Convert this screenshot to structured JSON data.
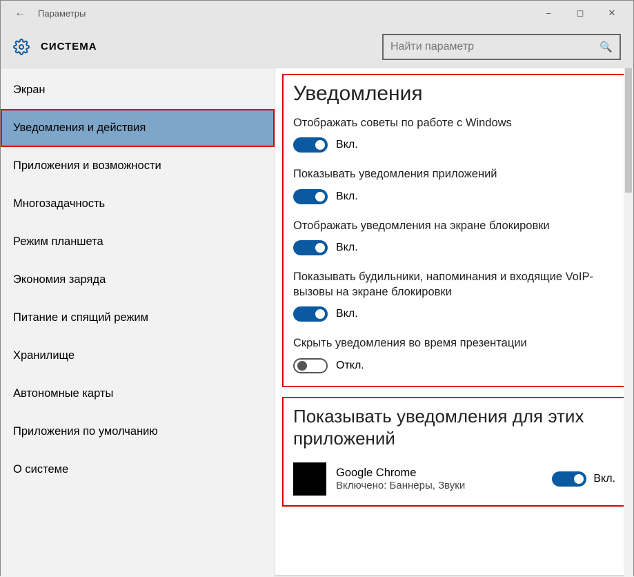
{
  "titlebar": {
    "title": "Параметры"
  },
  "header": {
    "section": "СИСТЕМА",
    "search_placeholder": "Найти параметр"
  },
  "sidebar": {
    "items": [
      {
        "label": "Экран"
      },
      {
        "label": "Уведомления и действия"
      },
      {
        "label": "Приложения и возможности"
      },
      {
        "label": "Многозадачность"
      },
      {
        "label": "Режим планшета"
      },
      {
        "label": "Экономия заряда"
      },
      {
        "label": "Питание и спящий режим"
      },
      {
        "label": "Хранилище"
      },
      {
        "label": "Автономные карты"
      },
      {
        "label": "Приложения по умолчанию"
      },
      {
        "label": "О системе"
      }
    ],
    "selected_index": 1
  },
  "toggle_states": {
    "on": "Вкл.",
    "off": "Откл."
  },
  "notifications": {
    "heading": "Уведомления",
    "settings": [
      {
        "label": "Отображать советы по работе с Windows",
        "on": true
      },
      {
        "label": "Показывать уведомления приложений",
        "on": true
      },
      {
        "label": "Отображать уведомления на экране блокировки",
        "on": true
      },
      {
        "label": "Показывать будильники, напоминания и входящие VoIP-вызовы на экране блокировки",
        "on": true
      },
      {
        "label": "Скрыть уведомления во время презентации",
        "on": false
      }
    ]
  },
  "apps_panel": {
    "heading": "Показывать уведомления для этих приложений",
    "apps": [
      {
        "name": "Google Chrome",
        "sub": "Включено: Баннеры, Звуки",
        "on": true
      }
    ]
  }
}
